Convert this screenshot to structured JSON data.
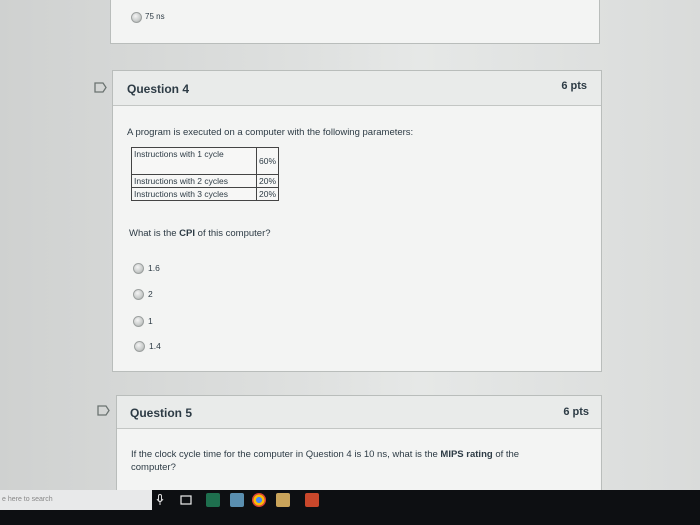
{
  "prev_question": {
    "answer_label": "75 ns"
  },
  "q4": {
    "title": "Question 4",
    "points": "6 pts",
    "prompt": "A program is executed on a computer with the following parameters:",
    "table": [
      {
        "label": "Instructions with 1 cycle",
        "value": "60%"
      },
      {
        "label": "Instructions with 2 cycles",
        "value": "20%"
      },
      {
        "label": "Instructions with 3 cycles",
        "value": "20%"
      }
    ],
    "question_pre": "What is the ",
    "question_bold": "CPI",
    "question_post": " of this computer?",
    "answers": [
      "1.6",
      "2",
      "1",
      "1.4"
    ]
  },
  "q5": {
    "title": "Question 5",
    "points": "6 pts",
    "prompt_pre": "If the clock cycle time for the computer in Question 4 is 10 ns, what is the ",
    "prompt_bold": "MIPS rating",
    "prompt_post": " of the",
    "prompt_line2": "computer?"
  },
  "taskbar": {
    "search_placeholder": "e here to search"
  },
  "colors": {
    "taskbar": "#0d0f12",
    "panel": "#f3f4f3",
    "header": "#e9ebea"
  }
}
